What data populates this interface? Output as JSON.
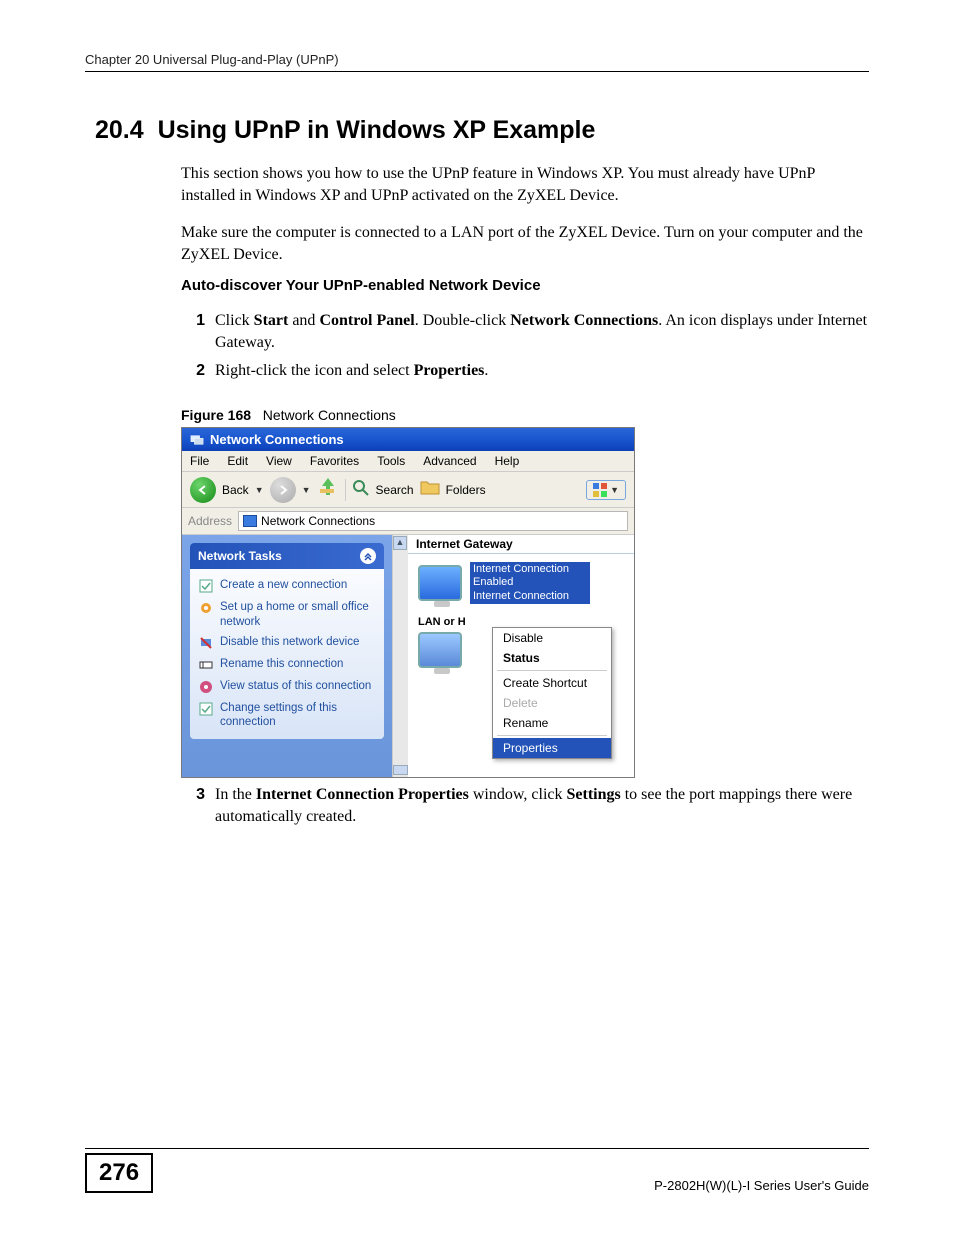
{
  "chapter_header": "Chapter 20 Universal Plug-and-Play (UPnP)",
  "section": {
    "number": "20.4",
    "title": "Using UPnP in Windows XP Example"
  },
  "paras": {
    "p1": "This section shows you how to use the UPnP feature in Windows XP. You must already have UPnP installed in Windows XP and UPnP activated on the ZyXEL Device.",
    "p2": "Make sure the computer is connected to a LAN port of the ZyXEL Device. Turn on your computer and the ZyXEL Device."
  },
  "sub_heading": "Auto-discover Your UPnP-enabled Network Device",
  "steps": {
    "s1": {
      "num": "1",
      "pre": "Click ",
      "b1": "Start",
      "mid1": " and ",
      "b2": "Control Panel",
      "mid2": ". Double-click ",
      "b3": "Network Connections",
      "post": ". An icon displays under Internet Gateway."
    },
    "s2": {
      "num": "2",
      "pre": "Right-click the icon and select ",
      "b1": "Properties",
      "post": "."
    },
    "s3": {
      "num": "3",
      "pre": "In the ",
      "b1": "Internet Connection Properties",
      "mid": " window, click ",
      "b2": "Settings",
      "post": " to see the port mappings there were automatically created."
    }
  },
  "figure": {
    "label": "Figure 168",
    "caption": "Network Connections"
  },
  "window": {
    "title": "Network Connections",
    "menus": [
      "File",
      "Edit",
      "View",
      "Favorites",
      "Tools",
      "Advanced",
      "Help"
    ],
    "toolbar": {
      "back": "Back",
      "search": "Search",
      "folders": "Folders"
    },
    "address_label": "Address",
    "address_value": "Network Connections",
    "tasks_header": "Network Tasks",
    "tasks": [
      "Create a new connection",
      "Set up a home or small office network",
      "Disable this network device",
      "Rename this connection",
      "View status of this connection",
      "Change settings of this connection"
    ],
    "group1": "Internet Gateway",
    "conn": {
      "line1": "Internet Connection",
      "line2": "Enabled",
      "line3": "Internet Connection"
    },
    "group2": "LAN or H",
    "context": {
      "disable": "Disable",
      "status": "Status",
      "shortcut": "Create Shortcut",
      "delete": "Delete",
      "rename": "Rename",
      "properties": "Properties"
    }
  },
  "footer": {
    "page": "276",
    "guide": "P-2802H(W)(L)-I Series User's Guide"
  }
}
